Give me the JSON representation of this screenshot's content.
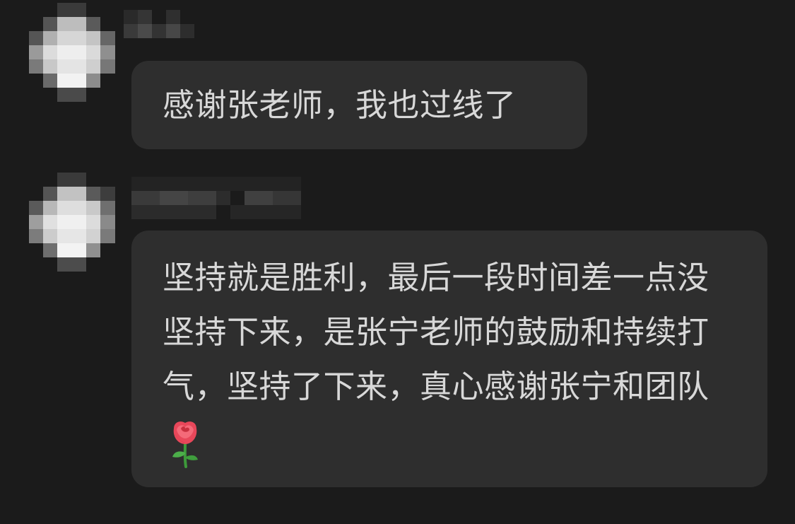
{
  "messages": [
    {
      "sender": "blurred-user-1",
      "text": "感谢张老师，我也过线了"
    },
    {
      "sender": "blurred-user-2",
      "text": "坚持就是胜利，最后一段时间差一点没坚持下来，是张宁老师的鼓励和持续打气，坚持了下来，真心感谢张宁和团队",
      "emoji": "rose-emoji"
    }
  ],
  "colors": {
    "background": "#1b1b1b",
    "bubble": "#2e2e2e",
    "text": "#d8d8d8"
  }
}
